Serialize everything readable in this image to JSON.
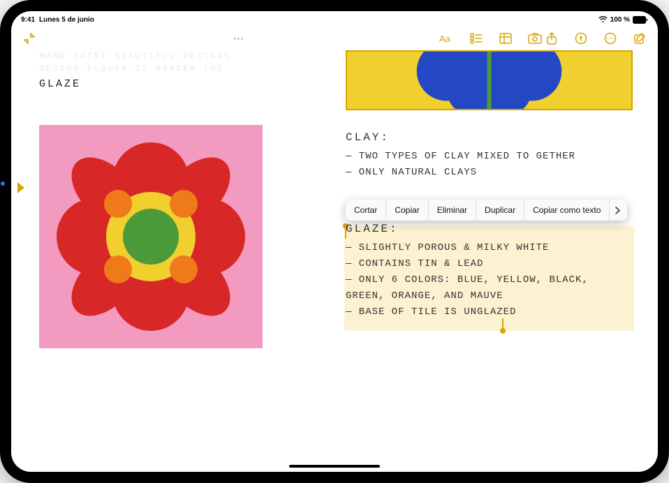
{
  "status": {
    "time": "9:41",
    "date": "Lunes 5 de junio",
    "battery": "100 %"
  },
  "toolbar": {
    "icons": {
      "collapse": "collapse-icon",
      "format": "format-icon",
      "checklist": "checklist-icon",
      "table": "table-icon",
      "camera": "camera-icon",
      "share": "share-icon",
      "markup": "markup-icon",
      "more": "more-icon",
      "compose": "compose-icon"
    }
  },
  "note": {
    "left": {
      "faded_line1": "HAND PAINT BEAUTIFUL DESIGNS",
      "faded_line2": "SECOND FLOWER IS HARDEN THE",
      "glaze_label": "GLAZE"
    },
    "right": {
      "clay": {
        "title": "CLAY:",
        "lines": [
          "— TWO TYPES OF CLAY MIXED TO GETHER",
          "— ONLY NATURAL CLAYS"
        ]
      },
      "glaze": {
        "title": "GLAZE:",
        "lines": [
          "— SLIGHTLY POROUS & MILKY WHITE",
          "— CONTAINS TIN & LEAD",
          "— ONLY 6 COLORS: BLUE, YELLOW, BLACK,",
          "   GREEN, ORANGE, AND MAUVE",
          "— BASE OF TILE IS UNGLAZED"
        ]
      }
    }
  },
  "context_menu": {
    "items": [
      "Cortar",
      "Copiar",
      "Eliminar",
      "Duplicar",
      "Copiar como texto"
    ]
  }
}
